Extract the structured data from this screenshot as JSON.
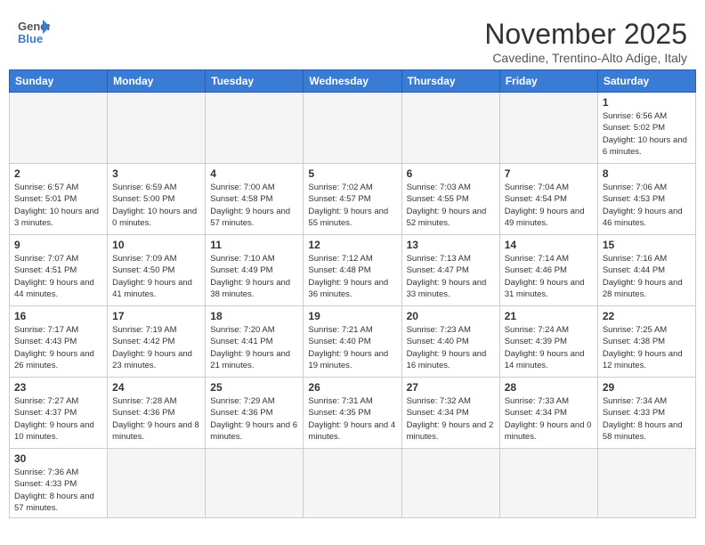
{
  "header": {
    "logo_general": "General",
    "logo_blue": "Blue",
    "month_title": "November 2025",
    "location": "Cavedine, Trentino-Alto Adige, Italy"
  },
  "weekdays": [
    "Sunday",
    "Monday",
    "Tuesday",
    "Wednesday",
    "Thursday",
    "Friday",
    "Saturday"
  ],
  "weeks": [
    [
      {
        "day": "",
        "info": ""
      },
      {
        "day": "",
        "info": ""
      },
      {
        "day": "",
        "info": ""
      },
      {
        "day": "",
        "info": ""
      },
      {
        "day": "",
        "info": ""
      },
      {
        "day": "",
        "info": ""
      },
      {
        "day": "1",
        "info": "Sunrise: 6:56 AM\nSunset: 5:02 PM\nDaylight: 10 hours\nand 6 minutes."
      }
    ],
    [
      {
        "day": "2",
        "info": "Sunrise: 6:57 AM\nSunset: 5:01 PM\nDaylight: 10 hours\nand 3 minutes."
      },
      {
        "day": "3",
        "info": "Sunrise: 6:59 AM\nSunset: 5:00 PM\nDaylight: 10 hours\nand 0 minutes."
      },
      {
        "day": "4",
        "info": "Sunrise: 7:00 AM\nSunset: 4:58 PM\nDaylight: 9 hours\nand 57 minutes."
      },
      {
        "day": "5",
        "info": "Sunrise: 7:02 AM\nSunset: 4:57 PM\nDaylight: 9 hours\nand 55 minutes."
      },
      {
        "day": "6",
        "info": "Sunrise: 7:03 AM\nSunset: 4:55 PM\nDaylight: 9 hours\nand 52 minutes."
      },
      {
        "day": "7",
        "info": "Sunrise: 7:04 AM\nSunset: 4:54 PM\nDaylight: 9 hours\nand 49 minutes."
      },
      {
        "day": "8",
        "info": "Sunrise: 7:06 AM\nSunset: 4:53 PM\nDaylight: 9 hours\nand 46 minutes."
      }
    ],
    [
      {
        "day": "9",
        "info": "Sunrise: 7:07 AM\nSunset: 4:51 PM\nDaylight: 9 hours\nand 44 minutes."
      },
      {
        "day": "10",
        "info": "Sunrise: 7:09 AM\nSunset: 4:50 PM\nDaylight: 9 hours\nand 41 minutes."
      },
      {
        "day": "11",
        "info": "Sunrise: 7:10 AM\nSunset: 4:49 PM\nDaylight: 9 hours\nand 38 minutes."
      },
      {
        "day": "12",
        "info": "Sunrise: 7:12 AM\nSunset: 4:48 PM\nDaylight: 9 hours\nand 36 minutes."
      },
      {
        "day": "13",
        "info": "Sunrise: 7:13 AM\nSunset: 4:47 PM\nDaylight: 9 hours\nand 33 minutes."
      },
      {
        "day": "14",
        "info": "Sunrise: 7:14 AM\nSunset: 4:46 PM\nDaylight: 9 hours\nand 31 minutes."
      },
      {
        "day": "15",
        "info": "Sunrise: 7:16 AM\nSunset: 4:44 PM\nDaylight: 9 hours\nand 28 minutes."
      }
    ],
    [
      {
        "day": "16",
        "info": "Sunrise: 7:17 AM\nSunset: 4:43 PM\nDaylight: 9 hours\nand 26 minutes."
      },
      {
        "day": "17",
        "info": "Sunrise: 7:19 AM\nSunset: 4:42 PM\nDaylight: 9 hours\nand 23 minutes."
      },
      {
        "day": "18",
        "info": "Sunrise: 7:20 AM\nSunset: 4:41 PM\nDaylight: 9 hours\nand 21 minutes."
      },
      {
        "day": "19",
        "info": "Sunrise: 7:21 AM\nSunset: 4:40 PM\nDaylight: 9 hours\nand 19 minutes."
      },
      {
        "day": "20",
        "info": "Sunrise: 7:23 AM\nSunset: 4:40 PM\nDaylight: 9 hours\nand 16 minutes."
      },
      {
        "day": "21",
        "info": "Sunrise: 7:24 AM\nSunset: 4:39 PM\nDaylight: 9 hours\nand 14 minutes."
      },
      {
        "day": "22",
        "info": "Sunrise: 7:25 AM\nSunset: 4:38 PM\nDaylight: 9 hours\nand 12 minutes."
      }
    ],
    [
      {
        "day": "23",
        "info": "Sunrise: 7:27 AM\nSunset: 4:37 PM\nDaylight: 9 hours\nand 10 minutes."
      },
      {
        "day": "24",
        "info": "Sunrise: 7:28 AM\nSunset: 4:36 PM\nDaylight: 9 hours\nand 8 minutes."
      },
      {
        "day": "25",
        "info": "Sunrise: 7:29 AM\nSunset: 4:36 PM\nDaylight: 9 hours\nand 6 minutes."
      },
      {
        "day": "26",
        "info": "Sunrise: 7:31 AM\nSunset: 4:35 PM\nDaylight: 9 hours\nand 4 minutes."
      },
      {
        "day": "27",
        "info": "Sunrise: 7:32 AM\nSunset: 4:34 PM\nDaylight: 9 hours\nand 2 minutes."
      },
      {
        "day": "28",
        "info": "Sunrise: 7:33 AM\nSunset: 4:34 PM\nDaylight: 9 hours\nand 0 minutes."
      },
      {
        "day": "29",
        "info": "Sunrise: 7:34 AM\nSunset: 4:33 PM\nDaylight: 8 hours\nand 58 minutes."
      }
    ],
    [
      {
        "day": "30",
        "info": "Sunrise: 7:36 AM\nSunset: 4:33 PM\nDaylight: 8 hours\nand 57 minutes."
      },
      {
        "day": "",
        "info": ""
      },
      {
        "day": "",
        "info": ""
      },
      {
        "day": "",
        "info": ""
      },
      {
        "day": "",
        "info": ""
      },
      {
        "day": "",
        "info": ""
      },
      {
        "day": "",
        "info": ""
      }
    ]
  ],
  "colors": {
    "header_bg": "#3a7bd5",
    "border": "#cccccc",
    "empty_bg": "#f5f5f5"
  }
}
